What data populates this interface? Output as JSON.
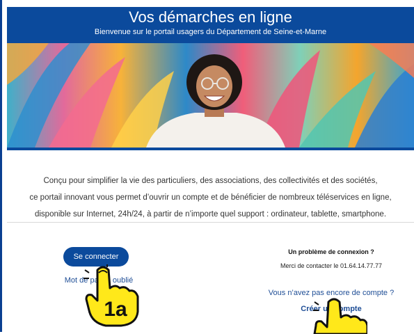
{
  "header": {
    "title": "Vos démarches en ligne",
    "subtitle": "Bienvenue sur le portail usagers du Département de Seine-et-Marne"
  },
  "intro": {
    "line1": "Conçu pour simplifier la vie des particuliers, des associations, des collectivités et des sociétés,",
    "line2": "ce portail innovant vous permet d’ouvrir un compte et de bénéficier de nombreux téléservices en ligne,",
    "line3": "disponible sur Internet, 24h/24, à partir de n’importe quel support : ordinateur, tablette, smartphone."
  },
  "login": {
    "connect_label": "Se connecter",
    "forgot_label": "Mot de passe oublié"
  },
  "help": {
    "title": "Un problème de connexion ?",
    "text": "Merci de contacter le 01.64.14.77.77",
    "no_account": "Vous n’avez pas encore de compte ?",
    "create_label": "Créer un compte"
  },
  "annotation": {
    "step_label": "1a"
  },
  "colors": {
    "brand_blue": "#0b4a9c",
    "link_blue": "#1f4e96",
    "hand_yellow": "#ffe81a"
  },
  "icons": {
    "pointer_hand": "pointer-hand-icon"
  }
}
